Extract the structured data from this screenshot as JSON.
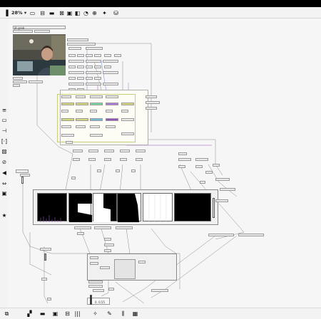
{
  "toolbar": {
    "zoom_label": "28%",
    "icons": [
      "sidebar-toggle-icon",
      "presentation-icon",
      "edit-icon",
      "record-icon",
      "patch-icon",
      "window-icon",
      "sync-icon",
      "clock-icon",
      "pin-icon",
      "paint-bucket-icon"
    ]
  },
  "patch": {
    "title_label": "jit.grab",
    "meter_label": "0. 0.55"
  },
  "sidebar": {
    "icons": [
      "menu-icon",
      "grid-icon",
      "audio-icon",
      "bracket-icon",
      "image-icon",
      "link-icon",
      "speaker-icon",
      "exchange-icon",
      "sampler-icon",
      "star-icon"
    ]
  },
  "bottombar": {
    "icons": [
      "lock-icon",
      "inspector-icon",
      "comment-icon",
      "presentation-window-icon",
      "toggle-icon",
      "meter-icon",
      "wand-icon",
      "wrench-icon",
      "mixer-icon",
      "clipboard-icon"
    ]
  },
  "colors": {
    "yellow_group": "#d4d87a",
    "cable_blue": "#6d8bd6",
    "cable_purple": "#9a4fbf",
    "cable_gray": "#8a8a8a"
  }
}
